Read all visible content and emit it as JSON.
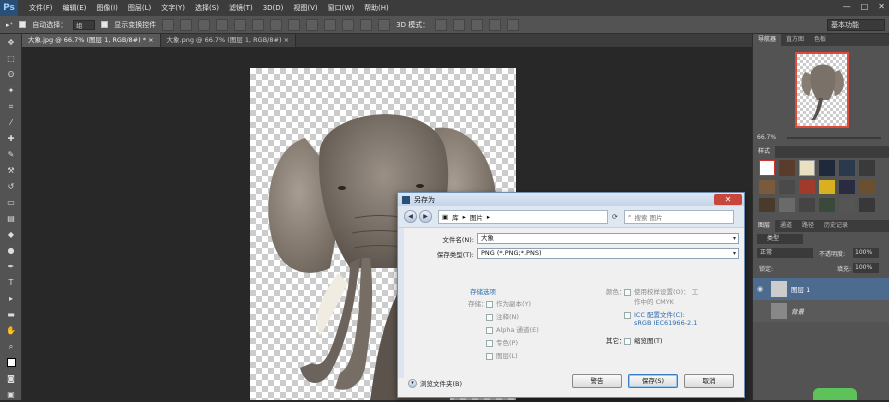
{
  "menubar": {
    "logo": "Ps",
    "items": [
      "文件(F)",
      "编辑(E)",
      "图像(I)",
      "图层(L)",
      "文字(Y)",
      "选择(S)",
      "滤镜(T)",
      "3D(D)",
      "视图(V)",
      "窗口(W)",
      "帮助(H)"
    ],
    "win_controls": [
      "—",
      "□",
      "✕"
    ]
  },
  "options": {
    "auto_select": "自动选择：",
    "group": "组",
    "show_transform": "显示变换控件",
    "mode_3d": "3D 模式：",
    "workspace": "基本功能"
  },
  "tabs": [
    {
      "label": "大象.jpg @ 66.7% (图层 1, RGB/8#) *",
      "close": "×"
    },
    {
      "label": "大象.png @ 66.7% (图层 1, RGB/8#)",
      "close": "×"
    }
  ],
  "panels": {
    "top_tabs": [
      "导航器",
      "直方图",
      "色板"
    ],
    "zoom": "66.7%",
    "styles_tab": "样式",
    "layers_tabs": [
      "图层",
      "通道",
      "路径",
      "历史记录"
    ],
    "kind": "类型",
    "blend": "正常",
    "opacity_label": "不透明度:",
    "opacity": "100%",
    "lock_label": "锁定:",
    "fill_label": "填充:",
    "fill": "100%",
    "layers": [
      {
        "name": "图层 1",
        "selected": true
      },
      {
        "name": "背景",
        "selected": false
      }
    ]
  },
  "dialog": {
    "title": "另存为",
    "close": "✕",
    "path": [
      "库",
      "图片"
    ],
    "search_placeholder": "搜索 图片",
    "filename_label": "文件名(N):",
    "filename": "大象",
    "format_label": "保存类型(T):",
    "format": "PNG (*.PNG;*.PNS)",
    "save_options": "存储选项",
    "save_label": "存储：",
    "as_copy": "作为副本(Y)",
    "notes": "注释(N)",
    "alpha": "Alpha 通道(E)",
    "spot": "专色(P)",
    "layers": "图层(L)",
    "color_label": "颜色：",
    "proof": "使用校样设置(O)： 工",
    "proof2": "作中的 CMYK",
    "icc": "ICC 配置文件(C):",
    "icc2": "sRGB IEC61966-2.1",
    "other_label": "其它：",
    "thumbnail": "缩览图(T)",
    "browse": "浏览文件夹(B)",
    "btn_warning": "警告",
    "btn_save": "保存(S)",
    "btn_cancel": "取消"
  }
}
